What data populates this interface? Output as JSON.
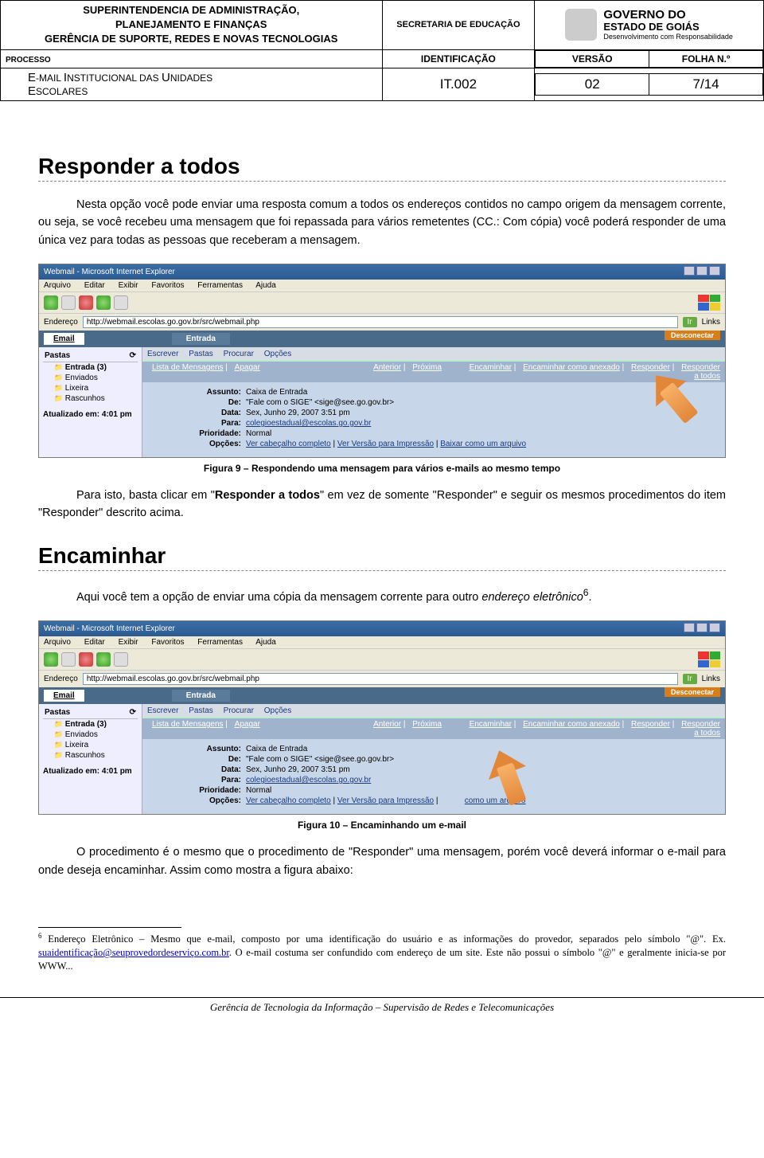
{
  "header": {
    "org_line1": "SUPERINTENDENCIA DE ADMINISTRAÇÃO,",
    "org_line2": "PLANEJAMENTO E FINANÇAS",
    "org_line3": "GERÊNCIA DE SUPORTE, REDES E NOVAS TECNOLOGIAS",
    "secretaria": "SECRETARIA DE EDUCAÇÃO",
    "gov_title": "GOVERNO DO",
    "gov_sub": "ESTADO DE GOIÁS",
    "gov_small": "Desenvolvimento com Responsabilidade",
    "lbl_processo": "PROCESSO",
    "lbl_ident": "IDENTIFICAÇÃO",
    "lbl_versao": "VERSÃO",
    "lbl_folha": "FOLHA N.º",
    "processo_line1": "E-MAIL INSTITUCIONAL DAS UNIDADES",
    "processo_line2": "ESCOLARES",
    "ident": "IT.002",
    "versao": "02",
    "folha": "7/14"
  },
  "sect1": {
    "title": "Responder a todos",
    "p1": "Nesta opção você pode enviar uma resposta comum a todos os endereços contidos no campo origem da mensagem corrente, ou seja, se você recebeu uma mensagem que foi repassada para vários remetentes (CC.: Com cópia) você poderá responder de uma única vez para todas as pessoas que receberam a mensagem.",
    "caption": "Figura 9 – Respondendo uma mensagem para vários e-mails ao mesmo tempo",
    "p2_a": "Para isto, basta clicar em \"",
    "p2_bold": "Responder a todos",
    "p2_b": "\" em vez de somente \"Responder\" e seguir os mesmos procedimentos do item \"Responder\" descrito acima."
  },
  "sect2": {
    "title": "Encaminhar",
    "p1_a": "Aqui você tem a opção de enviar uma cópia da mensagem corrente para outro ",
    "p1_i": "endereço eletrônico",
    "p1_sup": "6",
    "p1_b": ".",
    "caption": "Figura 10 – Encaminhando um e-mail",
    "p2": "O procedimento é o mesmo que o procedimento de \"Responder\" uma mensagem, porém você deverá informar o e-mail para onde deseja encaminhar. Assim como mostra a figura abaixo:"
  },
  "shot": {
    "title": "Webmail - Microsoft Internet Explorer",
    "menu": {
      "arquivo": "Arquivo",
      "editar": "Editar",
      "exibir": "Exibir",
      "favoritos": "Favoritos",
      "ferramentas": "Ferramentas",
      "ajuda": "Ajuda"
    },
    "addr_label": "Endereço",
    "addr_url": "http://webmail.escolas.go.gov.br/src/webmail.php",
    "go": "Ir",
    "links": "Links",
    "email_label": "Email",
    "entrada": "Entrada",
    "disconnect": "Desconectar",
    "pastas": "Pastas",
    "folders": {
      "entrada": "Entrada (3)",
      "enviados": "Enviados",
      "lixeira": "Lixeira",
      "rascunhos": "Rascunhos"
    },
    "updated": "Atualizado em: 4:01 pm",
    "toolbar": {
      "escrever": "Escrever",
      "pastas": "Pastas",
      "procurar": "Procurar",
      "opcoes": "Opções"
    },
    "listhdr": {
      "left_a": "Lista de Mensagens",
      "left_b": "Apagar",
      "center_a": "Anterior",
      "center_b": "Próxima",
      "r1": "Encaminhar",
      "r2": "Encaminhar como anexado",
      "r3": "Responder",
      "r4": "Responder a todos"
    },
    "msg": {
      "assunto_k": "Assunto:",
      "assunto_v": "Caixa de Entrada",
      "de_k": "De:",
      "de_v": "\"Fale com o SIGE\" <sige@see.go.gov.br>",
      "data_k": "Data:",
      "data_v": "Sex, Junho 29, 2007 3:51 pm",
      "para_k": "Para:",
      "para_v": "colegioestadual@escolas.go.gov.br",
      "prio_k": "Prioridade:",
      "prio_v": "Normal",
      "opc_k": "Opções:",
      "opc_a": "Ver cabeçalho completo",
      "opc_b": "Ver Versão para Impressão",
      "opc_c": "Baixar como um arquivo",
      "opc_c_short": "como um arquivo"
    }
  },
  "footnote": {
    "num": "6",
    "text_a": " Endereço Eletrônico – Mesmo que e-mail, composto por uma identificação do usuário e as informações do provedor, separados pelo símbolo \"@\". Ex. ",
    "link": "suaidentificação@seuprovedordeserviço.com.br",
    "text_b": ". O e-mail costuma ser confundido com endereço de um site. Este não possui o símbolo \"@\" e geralmente inicia-se por WWW..."
  },
  "footer": "Gerência de Tecnologia da Informação – Supervisão de Redes e Telecomunicações"
}
